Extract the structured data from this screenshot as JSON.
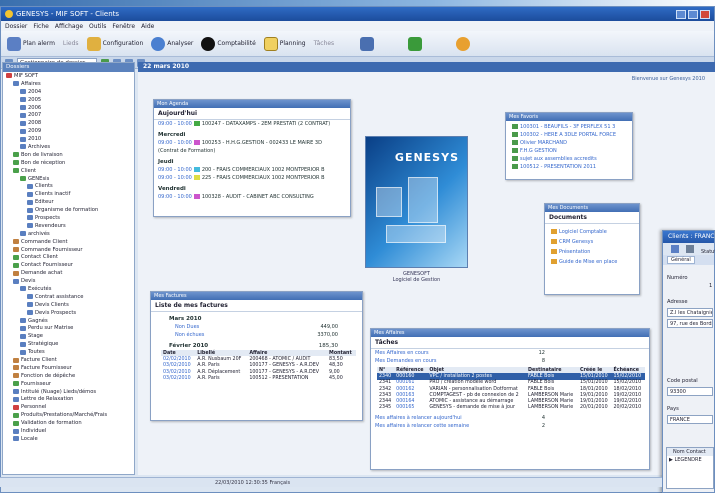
{
  "window": {
    "title": "GENESYS - MIF SOFT - Clients"
  },
  "menu": [
    "Dossier",
    "Fiche",
    "Affichage",
    "Outils",
    "Fenêtre",
    "Aide"
  ],
  "toolbar": {
    "b1": "Plan alerm",
    "b2": "Lieds",
    "b3": "Configuration",
    "b4": "Analyser",
    "b5": "Comptabilité",
    "b6": "Planning",
    "b7": "Tâches"
  },
  "subbar": {
    "combo": "Gestionnaire de dossier"
  },
  "tree": {
    "header": "Dossiers",
    "items": [
      {
        "t": "MIF SOFT",
        "c": "#d04040",
        "d": 0
      },
      {
        "t": "Affaires",
        "c": "#5a7fc0",
        "d": 1
      },
      {
        "t": "2004",
        "c": "#5a7fc0",
        "d": 2
      },
      {
        "t": "2005",
        "c": "#5a7fc0",
        "d": 2
      },
      {
        "t": "2006",
        "c": "#5a7fc0",
        "d": 2
      },
      {
        "t": "2007",
        "c": "#5a7fc0",
        "d": 2
      },
      {
        "t": "2008",
        "c": "#5a7fc0",
        "d": 2
      },
      {
        "t": "2009",
        "c": "#5a7fc0",
        "d": 2
      },
      {
        "t": "2010",
        "c": "#5a7fc0",
        "d": 2
      },
      {
        "t": "Archives",
        "c": "#5a7fc0",
        "d": 2
      },
      {
        "t": "Bon de livraison",
        "c": "#4aa04a",
        "d": 1
      },
      {
        "t": "Bon de réception",
        "c": "#4aa04a",
        "d": 1
      },
      {
        "t": "Client",
        "c": "#4aa04a",
        "d": 1
      },
      {
        "t": "GENEsis",
        "c": "#4aa04a",
        "d": 2
      },
      {
        "t": "Clients",
        "c": "#5a7fc0",
        "d": 3
      },
      {
        "t": "Clients inactif",
        "c": "#5a7fc0",
        "d": 3
      },
      {
        "t": "Editeur",
        "c": "#5a7fc0",
        "d": 3
      },
      {
        "t": "Organisme de formation",
        "c": "#5a7fc0",
        "d": 3
      },
      {
        "t": "Prospects",
        "c": "#5a7fc0",
        "d": 3
      },
      {
        "t": "Revendeurs",
        "c": "#5a7fc0",
        "d": 3
      },
      {
        "t": "archivés",
        "c": "#5a7fc0",
        "d": 2
      },
      {
        "t": "Commande Client",
        "c": "#c08040",
        "d": 1
      },
      {
        "t": "Commande Fournisseur",
        "c": "#c08040",
        "d": 1
      },
      {
        "t": "Contact Client",
        "c": "#4aa04a",
        "d": 1
      },
      {
        "t": "Contact Fournisseur",
        "c": "#4aa04a",
        "d": 1
      },
      {
        "t": "Demande achat",
        "c": "#c08040",
        "d": 1
      },
      {
        "t": "Devis",
        "c": "#5a7fc0",
        "d": 1
      },
      {
        "t": "Exécutés",
        "c": "#5a7fc0",
        "d": 2
      },
      {
        "t": "Contrat assistance",
        "c": "#5a7fc0",
        "d": 3
      },
      {
        "t": "Devis Clients",
        "c": "#5a7fc0",
        "d": 3
      },
      {
        "t": "Devis Prospects",
        "c": "#5a7fc0",
        "d": 3
      },
      {
        "t": "Gagnés",
        "c": "#5a7fc0",
        "d": 2
      },
      {
        "t": "Perdu sur Matrise",
        "c": "#5a7fc0",
        "d": 2
      },
      {
        "t": "Stage",
        "c": "#5a7fc0",
        "d": 2
      },
      {
        "t": "Stratégique",
        "c": "#5a7fc0",
        "d": 2
      },
      {
        "t": "Toutes",
        "c": "#5a7fc0",
        "d": 2
      },
      {
        "t": "Facture Client",
        "c": "#c08040",
        "d": 1
      },
      {
        "t": "Facture Fournisseur",
        "c": "#c08040",
        "d": 1
      },
      {
        "t": "Fonction de dépêche",
        "c": "#c08040",
        "d": 1
      },
      {
        "t": "Fournisseur",
        "c": "#4aa04a",
        "d": 1
      },
      {
        "t": "Intitulé (Nuage) Lieds/démos",
        "c": "#5a7fc0",
        "d": 1
      },
      {
        "t": "Lettre de Relaxation",
        "c": "#5a7fc0",
        "d": 1
      },
      {
        "t": "Personnel",
        "c": "#d04040",
        "d": 1
      },
      {
        "t": "Produits/Prestations/Marché/Frais",
        "c": "#4aa04a",
        "d": 1
      },
      {
        "t": "Validation de formation",
        "c": "#4aa04a",
        "d": 1
      },
      {
        "t": "Individuel",
        "c": "#5a7fc0",
        "d": 1
      },
      {
        "t": "Locale",
        "c": "#5a7fc0",
        "d": 1
      }
    ]
  },
  "content": {
    "date": "22 mars 2010",
    "note": "Bienvenue sur Genesys 2010"
  },
  "agenda": {
    "header": "Mon Agenda",
    "today": "Aujourd'hui",
    "days": [
      {
        "day": "",
        "lines": [
          {
            "time": "09:00 - 10:00",
            "sq": "#44aa44",
            "text": "100247 - DATAXAMPS - 2EM PRESTATI (2 CONTRAT)"
          }
        ]
      },
      {
        "day": "Mercredi",
        "lines": [
          {
            "time": "09:00 - 10:00",
            "sq": "#cc55cc",
            "text": "100253 - H.H.G.GESTION - 002433 LE MAIRE 3D"
          },
          {
            "time": "",
            "sq": "",
            "text": "(Contrat de Formation)"
          }
        ]
      },
      {
        "day": "Jeudi",
        "lines": [
          {
            "time": "09:00 - 10:00",
            "sq": "#44bbdd",
            "text": "200 - FRAIS COMMERCIAUX 1002 MONTPERIOR B"
          },
          {
            "time": "09:00 - 10:00",
            "sq": "#dddd44",
            "text": "225 - FRAIS COMMERCIAUX 1002 MONTPERIOR B"
          }
        ]
      },
      {
        "day": "Vendredi",
        "lines": [
          {
            "time": "09:00 - 10:00",
            "sq": "#cc55cc",
            "text": "100328 - AUDIT - CABINET ABC CONSULTING"
          }
        ]
      }
    ]
  },
  "logo": {
    "text": "GENESYS",
    "caption1": "GENESOFT",
    "caption2": "Logiciel de Gestion"
  },
  "bookmarks": {
    "header": "Mes Favoris",
    "items": [
      "100301 - BEAUFILS - 3F PERFLEX 51 3",
      "100302 - HERE A 3DLE PORTAL FORCE",
      "Olivier MARCHAND",
      "F.H.G GESTION",
      "sujet aux assemblies accredits",
      "100512 - PRESENTATION 2011"
    ]
  },
  "docs": {
    "header": "Mes Documents",
    "title": "Documents",
    "items": [
      "Logiciel Comptable",
      "CRM Genesys",
      "Présentation",
      "Guide de Mise en place"
    ]
  },
  "invoices": {
    "header": "Mes Factures",
    "title": "Liste de mes factures",
    "group1": "Mars 2010",
    "rows1": [
      {
        "a": "Non Dues",
        "b": "449,00"
      },
      {
        "a": "Non échues",
        "b": "3370,00"
      }
    ],
    "group2": "Février 2010",
    "g2val": "185,30",
    "cols": [
      "Date",
      "Libellé",
      "Affaire",
      "Montant"
    ],
    "rows": [
      [
        "02/02/2010",
        "A.R. Nusbaum 20F",
        "200468 - ATOMIC / AUDIT",
        "83,50"
      ],
      [
        "03/02/2010",
        "A.R. Paris",
        "100177 - GENESYS - A.R.DEV",
        "48,30"
      ],
      [
        "03/02/2010",
        "A.R. Déplacement",
        "100177 - GENESYS - A.R.DEV",
        "9,00"
      ],
      [
        "03/02/2010",
        "A.R. Paris",
        "100512 - PRESENTATION",
        "45,00"
      ]
    ]
  },
  "deals": {
    "header": "Mes Affaires",
    "title": "Tâches",
    "s1": "Mes Affaires en cours",
    "s1n": "12",
    "s2": "Mes Demandes en cours",
    "s2n": "8",
    "cols": [
      "N°",
      "Référence",
      "Objet",
      "Destinataire",
      "Créée le",
      "Échéance"
    ],
    "rows": [
      [
        "2340",
        "000160",
        "VPC / installation 2 postes",
        "FABLE Bois",
        "15/01/2010",
        "15/02/2010"
      ],
      [
        "2341",
        "000161",
        "PRO / création modèle word",
        "FABLE Bois",
        "15/01/2010",
        "15/02/2010"
      ],
      [
        "2342",
        "000162",
        "VARIAN - personnalisation Dotformat",
        "FABLE Bois",
        "18/01/2010",
        "18/02/2010"
      ],
      [
        "2343",
        "000163",
        "COMPTAGEST - pb de connexion de 2",
        "LAMBERSON Marie",
        "19/01/2010",
        "19/02/2010"
      ],
      [
        "2344",
        "000164",
        "ATOMIC - assistance au démarrage",
        "LAMBERSON Marie",
        "19/01/2010",
        "19/02/2010"
      ],
      [
        "2345",
        "000165",
        "GENESYS - demande de mise à jour",
        "LAMBERSON Marie",
        "20/01/2010",
        "20/02/2010"
      ]
    ],
    "f1": "Mes affaires à relancer aujourd'hui",
    "f1n": "4",
    "f2": "Mes affaires à relancer cette semaine",
    "f2n": "2"
  },
  "client": {
    "title": "Clients : FRANCE",
    "tab": "Général",
    "tab2": "Statut",
    "l_num": "Numéro",
    "v_num": "1",
    "l_addr": "Adresse",
    "v_addr1": "Z.I les Chataigniers",
    "v_addr2": "97, rue des Bords",
    "l_cp": "Code postal",
    "v_cp": "93300",
    "l_pays": "Pays",
    "v_pays": "FRANCE",
    "grid_head": "Nom Contact",
    "grid_row": "LEGENDRE"
  },
  "status": {
    "text": "22/03/2010 12:30:35   Français"
  },
  "colors": {
    "accent": "#3d6ab0",
    "title": "#1c4c9c"
  }
}
